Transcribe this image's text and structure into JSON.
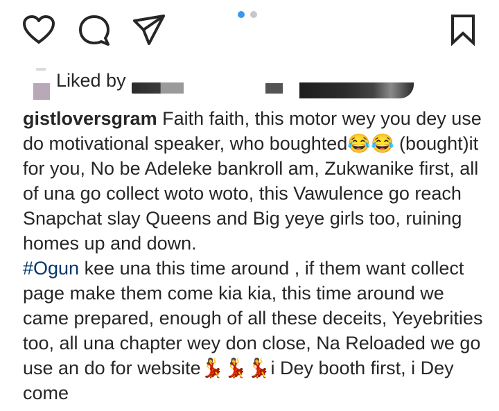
{
  "actions": {
    "like_icon": "heart-icon",
    "comment_icon": "speech-bubble-icon",
    "share_icon": "paper-plane-icon",
    "save_icon": "bookmark-icon"
  },
  "carousel": {
    "count": 2,
    "active_index": 0,
    "active_color": "#3897f0",
    "inactive_color": "#c7c7c7"
  },
  "likes": {
    "text": "Liked by"
  },
  "caption": {
    "username": "gistloversgram",
    "part1": " Faith faith, this motor wey you dey use do motivational speaker, who boughted😂😂 (bought)it for you, No be Adeleke bankroll am, Zukwanike first, all of una go collect woto woto, this Vawulence go reach Snapchat slay Queens and Big yeye girls too, ruining homes up and down.\n",
    "hashtag": "#Ogun",
    "part2": " kee una this time around , if them want collect page make them come kia kia, this time around we came prepared, enough of all these deceits, Yeyebrities too, all una chapter wey don close, Na Reloaded we go use an do for website💃💃💃i Dey booth first, i Dey come"
  },
  "colors": {
    "text": "#262626",
    "hashtag": "#00376b"
  }
}
